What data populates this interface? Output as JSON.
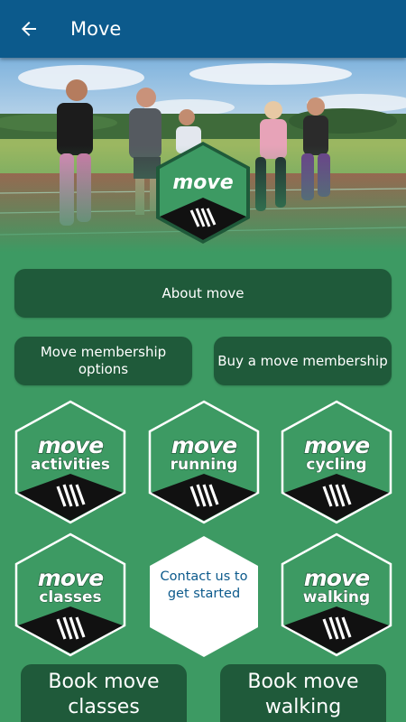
{
  "appbar": {
    "title": "Move",
    "back_icon": "arrow-left-icon",
    "background": "#0c5a8c"
  },
  "hero": {
    "image": "group-walking-on-running-track-photo",
    "logo_text": "move"
  },
  "buttons": {
    "about": "About move",
    "membership_options": "Move membership options",
    "buy_membership": "Buy a move membership"
  },
  "tiles": [
    {
      "brand": "move",
      "label": "activities"
    },
    {
      "brand": "move",
      "label": "running"
    },
    {
      "brand": "move",
      "label": "cycling"
    },
    {
      "brand": "move",
      "label": "classes"
    },
    {
      "label": "Contact us to get started"
    },
    {
      "brand": "move",
      "label": "walking"
    }
  ],
  "book": {
    "classes": "Book move classes",
    "walking": "Book move walking"
  },
  "colors": {
    "page_bg": "#3d9a63",
    "button_bg": "#1f5a3a",
    "tile_fill": "#3d9a63",
    "tile_border": "#ffffff",
    "tile_base": "#111111",
    "contact_text": "#0c5a8c"
  }
}
